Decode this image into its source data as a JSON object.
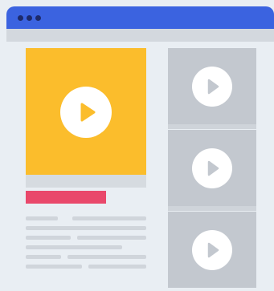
{
  "colors": {
    "titlebar": "#3b63e0",
    "dots": "#1d2a6b",
    "main_card": "#fbbd2c",
    "accent_bar": "#e9486b",
    "thumbnail": "#c3c8cf",
    "play_fill_main": "#fbbd2c",
    "play_fill_thumb": "#c3c8cf"
  },
  "icons": {
    "main_play": "play-icon",
    "thumbnail_play": "play-icon"
  },
  "thumbnails": [
    "video-1",
    "video-2",
    "video-3"
  ]
}
